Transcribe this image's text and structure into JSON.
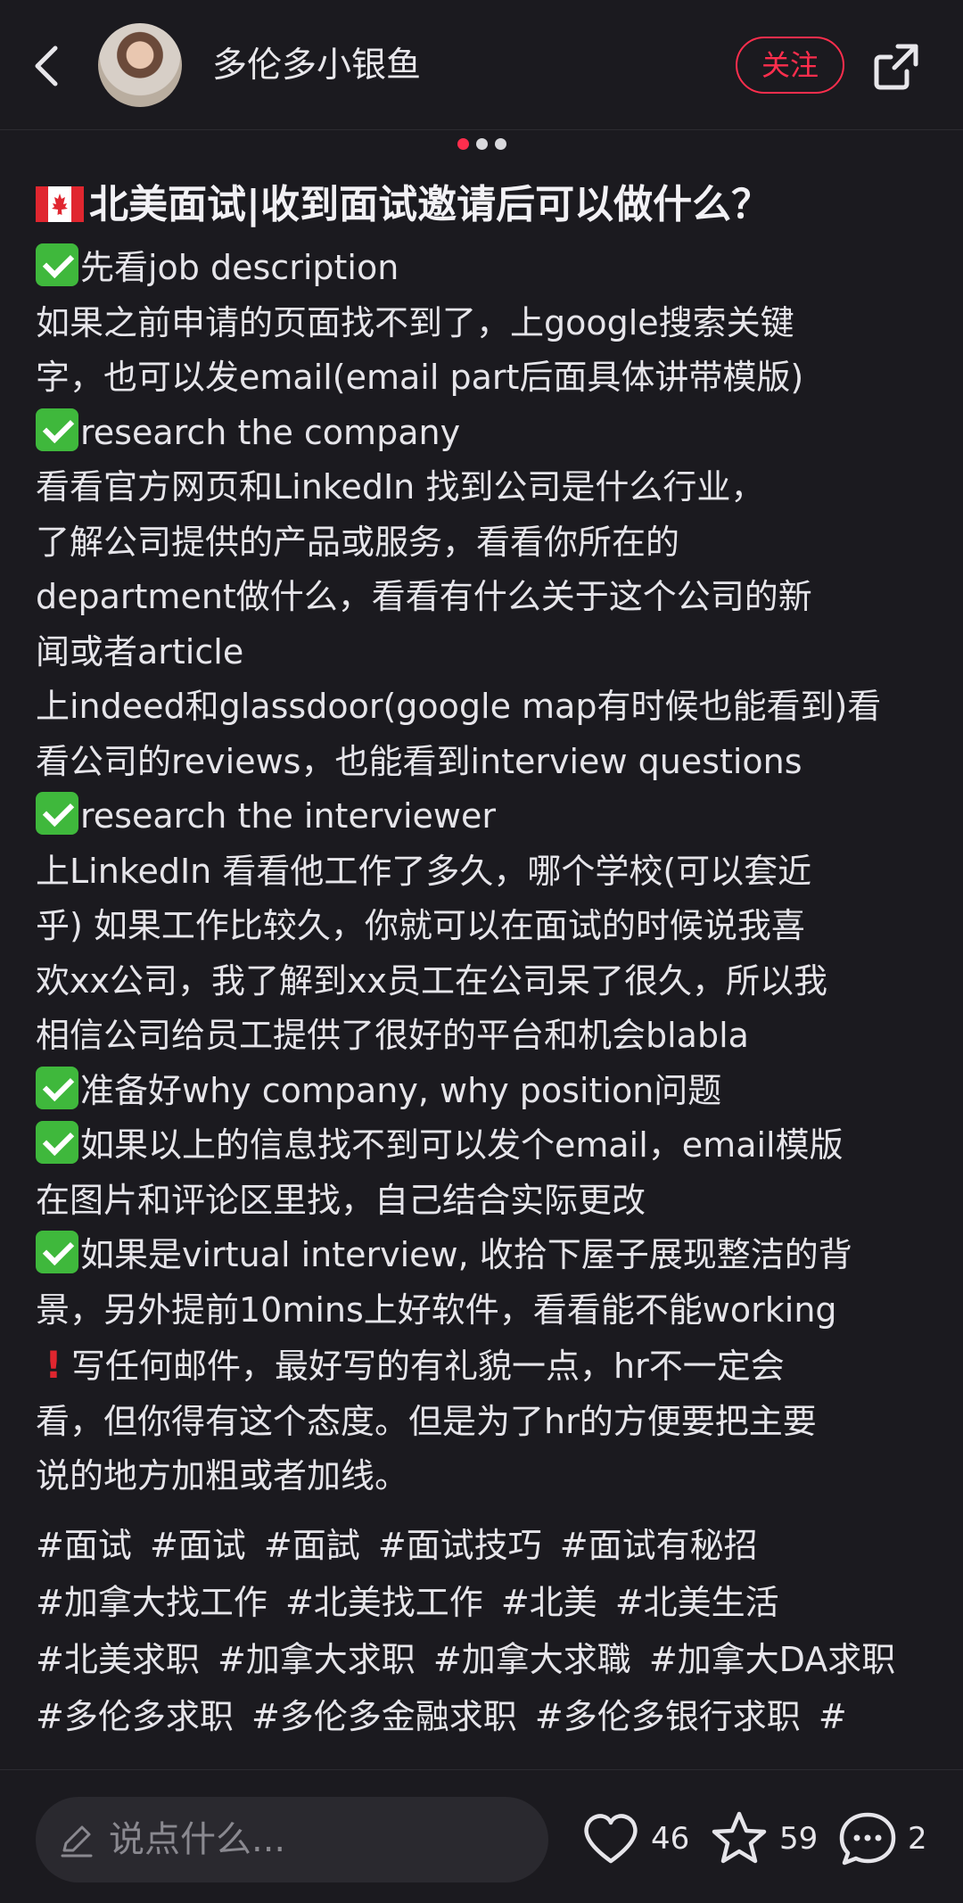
{
  "header": {
    "author": "多伦多小银鱼",
    "follow_label": "关注"
  },
  "carousel": {
    "total": 3,
    "active": 1
  },
  "post": {
    "title": "北美面试|收到面试邀请后可以做什么？",
    "lines": [
      {
        "check": true,
        "text": "先看job description"
      },
      {
        "text": "如果之前申请的页面找不到了，上google搜索关键"
      },
      {
        "text": "字，也可以发email(email part后面具体讲带模版)"
      },
      {
        "check": true,
        "text": "research the company"
      },
      {
        "text": "看看官方网页和LinkedIn 找到公司是什么行业，"
      },
      {
        "text": "了解公司提供的产品或服务，看看你所在的"
      },
      {
        "text": "department做什么，看看有什么关于这个公司的新"
      },
      {
        "text": "闻或者article"
      },
      {
        "text": "上indeed和glassdoor(google map有时候也能看到)看"
      },
      {
        "text": "看公司的reviews，也能看到interview questions"
      },
      {
        "check": true,
        "text": "research the interviewer"
      },
      {
        "text": "上LinkedIn 看看他工作了多久，哪个学校(可以套近"
      },
      {
        "text": "乎) 如果工作比较久，你就可以在面试的时候说我喜"
      },
      {
        "text": "欢xx公司，我了解到xx员工在公司呆了很久，所以我"
      },
      {
        "text": "相信公司给员工提供了很好的平台和机会blabla"
      },
      {
        "check": true,
        "text": "准备好why company, why position问题"
      },
      {
        "check": true,
        "text": "如果以上的信息找不到可以发个email，email模版"
      },
      {
        "text": "在图片和评论区里找，自己结合实际更改"
      },
      {
        "check": true,
        "text": "如果是virtual interview, 收拾下屋子展现整洁的背"
      },
      {
        "text": "景，另外提前10mins上好软件，看看能不能working"
      },
      {
        "excl": true,
        "text": "写任何邮件，最好写的有礼貌一点，hr不一定会"
      },
      {
        "text": "看，但你得有这个态度。但是为了hr的方便要把主要"
      },
      {
        "text": "说的地方加粗或者加线。"
      }
    ],
    "tags": [
      "#面试",
      "#面试",
      "#面試",
      "#面试技巧",
      "#面试有秘招",
      "#加拿大找工作",
      "#北美找工作",
      "#北美",
      "#北美生活",
      "#北美求职",
      "#加拿大求职",
      "#加拿大求職",
      "#加拿大DA求职",
      "#多伦多求职",
      "#多伦多金融求职",
      "#多伦多银行求职",
      "#"
    ]
  },
  "bottom_bar": {
    "comment_placeholder": "说点什么...",
    "likes": "46",
    "favorites": "59",
    "comments": "2"
  }
}
